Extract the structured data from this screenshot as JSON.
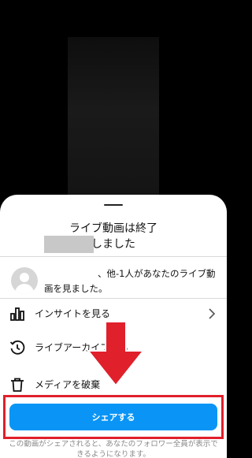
{
  "sheet": {
    "title": "ライブ動画は終了\nしました"
  },
  "viewers": {
    "text": "、他-1人があなたのライブ動画を見ました。"
  },
  "menu": {
    "insights_label": "インサイトを見る",
    "archive_label": "ライブアーカイブ",
    "archive_label_tail": "る",
    "discard_label": "メディアを破棄"
  },
  "share": {
    "button_label": "シェアする",
    "footnote": "この動画がシェアされると、あなたのフォロワー全員が表示できるようになります。"
  },
  "colors": {
    "share_blue": "#0a95f6",
    "highlight_red": "#e0202b"
  }
}
